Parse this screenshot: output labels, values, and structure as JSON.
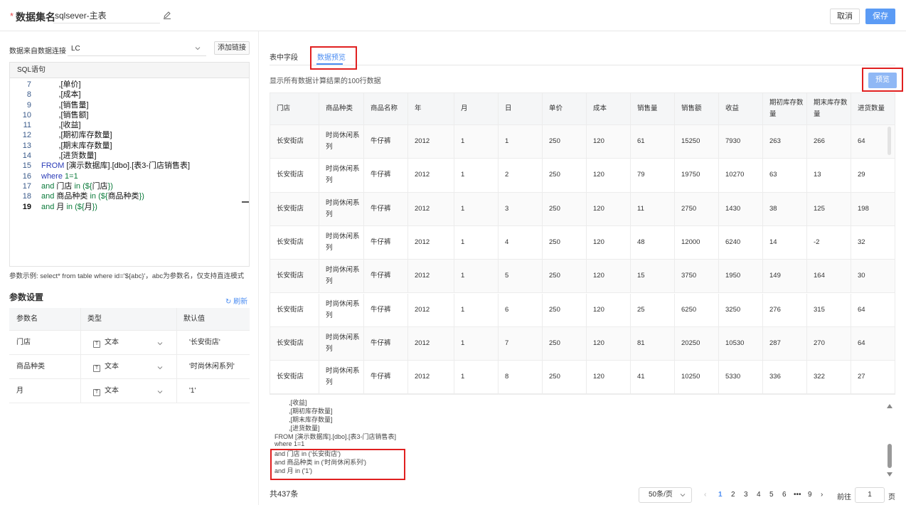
{
  "header": {
    "required_mark": "*",
    "title": "数据集名",
    "dataset_name": "sqlsever-主表",
    "cancel_label": "取消",
    "save_label": "保存"
  },
  "left": {
    "source_label": "数据来自数据连接",
    "connection_value": "LC",
    "add_link_label": "添加链接",
    "sql_header": "SQL语句",
    "code_lines": [
      {
        "n": "7",
        "parts": [
          {
            "t": "        ,[单价]",
            "c": "tx"
          }
        ]
      },
      {
        "n": "8",
        "parts": [
          {
            "t": "        ,[成本]",
            "c": "tx"
          }
        ]
      },
      {
        "n": "9",
        "parts": [
          {
            "t": "        ,[销售量]",
            "c": "tx"
          }
        ]
      },
      {
        "n": "10",
        "parts": [
          {
            "t": "        ,[销售额]",
            "c": "tx"
          }
        ]
      },
      {
        "n": "11",
        "parts": [
          {
            "t": "        ,[收益]",
            "c": "tx"
          }
        ]
      },
      {
        "n": "12",
        "parts": [
          {
            "t": "        ,[期初库存数量]",
            "c": "tx"
          }
        ]
      },
      {
        "n": "13",
        "parts": [
          {
            "t": "        ,[期末库存数量]",
            "c": "tx"
          }
        ]
      },
      {
        "n": "14",
        "parts": [
          {
            "t": "        ,[进货数量]",
            "c": "tx"
          }
        ]
      },
      {
        "n": "15",
        "parts": [
          {
            "t": "FROM ",
            "c": "kw"
          },
          {
            "t": "[演示数据库].[dbo].[表3-门店销售表]",
            "c": "tx"
          }
        ]
      },
      {
        "n": "16",
        "parts": [
          {
            "t": "where ",
            "c": "kw"
          },
          {
            "t": "1=1",
            "c": "pr"
          }
        ]
      },
      {
        "n": "17",
        "parts": [
          {
            "t": "and ",
            "c": "pr"
          },
          {
            "t": "门店",
            "c": "tx"
          },
          {
            "t": " in (${",
            "c": "pr"
          },
          {
            "t": "门店",
            "c": "tx"
          },
          {
            "t": "})",
            "c": "pr"
          }
        ]
      },
      {
        "n": "18",
        "parts": [
          {
            "t": "and ",
            "c": "pr"
          },
          {
            "t": "商品种类",
            "c": "tx"
          },
          {
            "t": " in (${",
            "c": "pr"
          },
          {
            "t": "商品种类",
            "c": "tx"
          },
          {
            "t": "})",
            "c": "pr"
          }
        ]
      },
      {
        "n": "19",
        "parts": [
          {
            "t": "and ",
            "c": "pr"
          },
          {
            "t": "月",
            "c": "tx"
          },
          {
            "t": " in (${",
            "c": "pr"
          },
          {
            "t": "月",
            "c": "tx"
          },
          {
            "t": "})",
            "c": "pr"
          }
        ]
      }
    ],
    "hint": "参数示例: select* from table where id='${abc}'，abc为参数名，仅支持直连模式",
    "params_title": "参数设置",
    "refresh_label": "刷新",
    "param_headers": [
      "参数名",
      "类型",
      "默认值"
    ],
    "params": [
      {
        "name": "门店",
        "type": "文本",
        "default": "'长安街店'"
      },
      {
        "name": "商品种类",
        "type": "文本",
        "default": "'时尚休闲系列'"
      },
      {
        "name": "月",
        "type": "文本",
        "default": "'1'"
      }
    ]
  },
  "right": {
    "tab_fields": "表中字段",
    "tab_preview": "数据预览",
    "show_all": "显示所有数据计算结果的100行数据",
    "preview_label": "预览",
    "columns": [
      "门店",
      "商品种类",
      "商品名称",
      "年",
      "月",
      "日",
      "单价",
      "成本",
      "销售量",
      "销售额",
      "收益",
      "期初库存数量",
      "期末库存数量",
      "进货数量"
    ],
    "rows": [
      [
        "长安街店",
        "时尚休闲系列",
        "牛仔裤",
        "2012",
        "1",
        "1",
        "250",
        "120",
        "61",
        "15250",
        "7930",
        "263",
        "266",
        "64"
      ],
      [
        "长安街店",
        "时尚休闲系列",
        "牛仔裤",
        "2012",
        "1",
        "2",
        "250",
        "120",
        "79",
        "19750",
        "10270",
        "63",
        "13",
        "29"
      ],
      [
        "长安街店",
        "时尚休闲系列",
        "牛仔裤",
        "2012",
        "1",
        "3",
        "250",
        "120",
        "11",
        "2750",
        "1430",
        "38",
        "125",
        "198"
      ],
      [
        "长安街店",
        "时尚休闲系列",
        "牛仔裤",
        "2012",
        "1",
        "4",
        "250",
        "120",
        "48",
        "12000",
        "6240",
        "14",
        "-2",
        "32"
      ],
      [
        "长安街店",
        "时尚休闲系列",
        "牛仔裤",
        "2012",
        "1",
        "5",
        "250",
        "120",
        "15",
        "3750",
        "1950",
        "149",
        "164",
        "30"
      ],
      [
        "长安街店",
        "时尚休闲系列",
        "牛仔裤",
        "2012",
        "1",
        "6",
        "250",
        "120",
        "25",
        "6250",
        "3250",
        "276",
        "315",
        "64"
      ],
      [
        "长安街店",
        "时尚休闲系列",
        "牛仔裤",
        "2012",
        "1",
        "7",
        "250",
        "120",
        "81",
        "20250",
        "10530",
        "287",
        "270",
        "64"
      ],
      [
        "长安街店",
        "时尚休闲系列",
        "牛仔裤",
        "2012",
        "1",
        "8",
        "250",
        "120",
        "41",
        "10250",
        "5330",
        "336",
        "322",
        "27"
      ]
    ],
    "sql_preview_lines": [
      "        ,[收益]",
      "        ,[期初库存数量]",
      "        ,[期末库存数量]",
      "        ,[进货数量]",
      "FROM [演示数据库].[dbo].[表3-门店销售表]",
      "where 1=1",
      "and 门店 in ('长安街店')",
      "and 商品种类 in ('时尚休闲系列')",
      "and 月 in ('1')"
    ]
  },
  "footer": {
    "total": "共437条",
    "page_size": "50条/页",
    "pages": [
      "1",
      "2",
      "3",
      "4",
      "5",
      "6",
      "•••",
      "9"
    ],
    "goto_label": "前往",
    "goto_value": "1",
    "page_suffix": "页"
  }
}
